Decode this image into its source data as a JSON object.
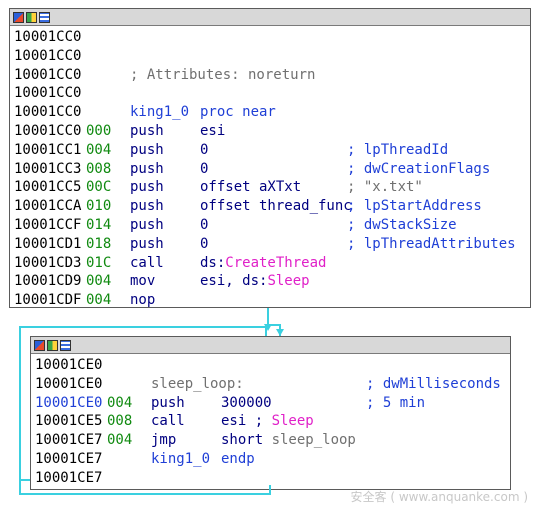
{
  "block1": {
    "lines": [
      {
        "addr": "10001CC0",
        "sp": "",
        "mn": "",
        "op": "",
        "cm": ""
      },
      {
        "addr": "10001CC0",
        "sp": "",
        "mn": "",
        "op": "",
        "cm": ""
      },
      {
        "addr": "10001CC0",
        "sp": "",
        "mn": "; Attributes: noreturn",
        "op": "",
        "cm": ""
      },
      {
        "addr": "10001CC0",
        "sp": "",
        "mn": "",
        "op": "",
        "cm": ""
      },
      {
        "addr": "10001CC0",
        "sp": "",
        "mn": "king1_0",
        "op": "proc near",
        "cm": ""
      },
      {
        "addr": "10001CC0",
        "sp": "000",
        "mn": "push",
        "op": "esi",
        "cm": ""
      },
      {
        "addr": "10001CC1",
        "sp": "004",
        "mn": "push",
        "op": "0",
        "cm": "; lpThreadId"
      },
      {
        "addr": "10001CC3",
        "sp": "008",
        "mn": "push",
        "op": "0",
        "cm": "; dwCreationFlags"
      },
      {
        "addr": "10001CC5",
        "sp": "00C",
        "mn": "push",
        "op": "offset aXTxt",
        "cm": "; \"x.txt\""
      },
      {
        "addr": "10001CCA",
        "sp": "010",
        "mn": "push",
        "op": "offset thread_func",
        "cm": "; lpStartAddress"
      },
      {
        "addr": "10001CCF",
        "sp": "014",
        "mn": "push",
        "op": "0",
        "cm": "; dwStackSize"
      },
      {
        "addr": "10001CD1",
        "sp": "018",
        "mn": "push",
        "op": "0",
        "cm": "; lpThreadAttributes"
      },
      {
        "addr": "10001CD3",
        "sp": "01C",
        "mn": "call",
        "op_prefix": "ds:",
        "op_import": "CreateThread",
        "cm": ""
      },
      {
        "addr": "10001CD9",
        "sp": "004",
        "mn": "mov",
        "op_prefix": "esi, ds:",
        "op_import": "Sleep",
        "cm": ""
      },
      {
        "addr": "10001CDF",
        "sp": "004",
        "mn": "nop",
        "op": "",
        "cm": ""
      }
    ]
  },
  "block2": {
    "lines": [
      {
        "addr": "10001CE0",
        "sp": "",
        "mn": "",
        "op": "",
        "cm": ""
      },
      {
        "addr": "10001CE0",
        "sp": "",
        "mn": "sleep_loop:",
        "op": "",
        "cm": "; dwMilliseconds"
      },
      {
        "addr": "10001CE0",
        "sp": "004",
        "mn": "push",
        "op": "300000",
        "cm": "; 5 min"
      },
      {
        "addr": "10001CE5",
        "sp": "008",
        "mn": "call",
        "op": "esi ; ",
        "op_import": "Sleep",
        "cm": ""
      },
      {
        "addr": "10001CE7",
        "sp": "004",
        "mn": "jmp",
        "op": "short ",
        "op_ref": "sleep_loop",
        "cm": ""
      },
      {
        "addr": "10001CE7",
        "sp": "",
        "mn": "king1_0",
        "op": "endp",
        "cm": ""
      },
      {
        "addr": "10001CE7",
        "sp": "",
        "mn": "",
        "op": "",
        "cm": ""
      }
    ]
  },
  "watermark": "安全客 ( www.anquanke.com )",
  "colors": {
    "address": "#000000",
    "address_current": "#1f3fd6",
    "stack_pointer": "#108a10",
    "instruction": "#000080",
    "comment": "#1f3fd6",
    "import": "#e020c8",
    "flow_edge": "#3ad0e0"
  }
}
